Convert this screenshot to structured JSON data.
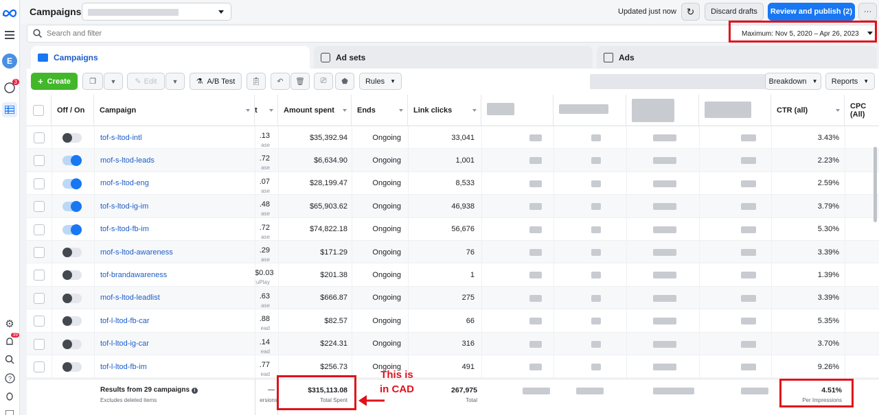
{
  "header": {
    "title": "Campaigns",
    "updated": "Updated just now",
    "discard": "Discard drafts",
    "publish": "Review and publish (2)",
    "more": "···"
  },
  "rail": {
    "avatar": "E",
    "badge_top": "3",
    "badge_bottom": "39"
  },
  "search": {
    "placeholder": "Search and filter",
    "date_range": "Maximum: Nov 5, 2020 – Apr 26, 2023"
  },
  "tabs": {
    "campaigns": "Campaigns",
    "adsets": "Ad sets",
    "ads": "Ads"
  },
  "toolbar": {
    "create": "Create",
    "edit": "Edit",
    "abtest": "A/B Test",
    "rules": "Rules",
    "breakdown": "Breakdown",
    "reports": "Reports"
  },
  "columns": {
    "off_on": "Off / On",
    "campaign": "Campaign",
    "partial": "t",
    "amount": "Amount spent",
    "ends": "Ends",
    "clicks": "Link clicks",
    "ctr": "CTR (all)",
    "cpc": "CPC (All)"
  },
  "rows": [
    {
      "name": "tof-s-ltod-intl",
      "on": false,
      "partial": ".13",
      "partial_sub": "ase",
      "amount": "$35,392.94",
      "ends": "Ongoing",
      "clicks": "33,041",
      "ctr": "3.43%"
    },
    {
      "name": "mof-s-ltod-leads",
      "on": true,
      "partial": ".72",
      "partial_sub": "ase",
      "amount": "$6,634.90",
      "ends": "Ongoing",
      "clicks": "1,001",
      "ctr": "2.23%"
    },
    {
      "name": "mof-s-ltod-eng",
      "on": true,
      "partial": ".07",
      "partial_sub": "ase",
      "amount": "$28,199.47",
      "ends": "Ongoing",
      "clicks": "8,533",
      "ctr": "2.59%"
    },
    {
      "name": "tof-s-ltod-ig-im",
      "on": true,
      "partial": ".48",
      "partial_sub": "ase",
      "amount": "$65,903.62",
      "ends": "Ongoing",
      "clicks": "46,938",
      "ctr": "3.79%"
    },
    {
      "name": "tof-s-ltod-fb-im",
      "on": true,
      "partial": ".72",
      "partial_sub": "ase",
      "amount": "$74,822.18",
      "ends": "Ongoing",
      "clicks": "56,676",
      "ctr": "5.30%"
    },
    {
      "name": "mof-s-ltod-awareness",
      "on": false,
      "partial": ".29",
      "partial_sub": "ase",
      "amount": "$171.29",
      "ends": "Ongoing",
      "clicks": "76",
      "ctr": "3.39%"
    },
    {
      "name": "tof-brandawareness",
      "on": false,
      "partial": "$0.03",
      "partial_sub": "ruPlay",
      "amount": "$201.38",
      "ends": "Ongoing",
      "clicks": "1",
      "ctr": "1.39%"
    },
    {
      "name": "mof-s-ltod-leadlist",
      "on": false,
      "partial": ".63",
      "partial_sub": "ase",
      "amount": "$666.87",
      "ends": "Ongoing",
      "clicks": "275",
      "ctr": "3.39%"
    },
    {
      "name": "tof-l-ltod-fb-car",
      "on": false,
      "partial": ".88",
      "partial_sub": "ead",
      "amount": "$82.57",
      "ends": "Ongoing",
      "clicks": "66",
      "ctr": "5.35%"
    },
    {
      "name": "tof-l-ltod-ig-car",
      "on": false,
      "partial": ".14",
      "partial_sub": "ead",
      "amount": "$224.31",
      "ends": "Ongoing",
      "clicks": "316",
      "ctr": "3.70%"
    },
    {
      "name": "tof-l-ltod-fb-im",
      "on": false,
      "partial": ".77",
      "partial_sub": "ead",
      "amount": "$256.73",
      "ends": "Ongoing",
      "clicks": "491",
      "ctr": "9.26%"
    }
  ],
  "footer": {
    "results": "Results from 29 campaigns",
    "excludes": "Excludes deleted items",
    "partial": "—",
    "partial_sub": "ersions",
    "total_spent": "$315,113.08",
    "total_spent_label": "Total Spent",
    "total_clicks": "267,975",
    "total_clicks_label": "Total",
    "ctr": "4.51%",
    "ctr_label": "Per Impressions"
  },
  "annotation": {
    "line1": "This is",
    "line2": "in CAD"
  },
  "colors": {
    "accent": "#1877f2",
    "create": "#42b72a",
    "highlight": "#e0111a"
  }
}
